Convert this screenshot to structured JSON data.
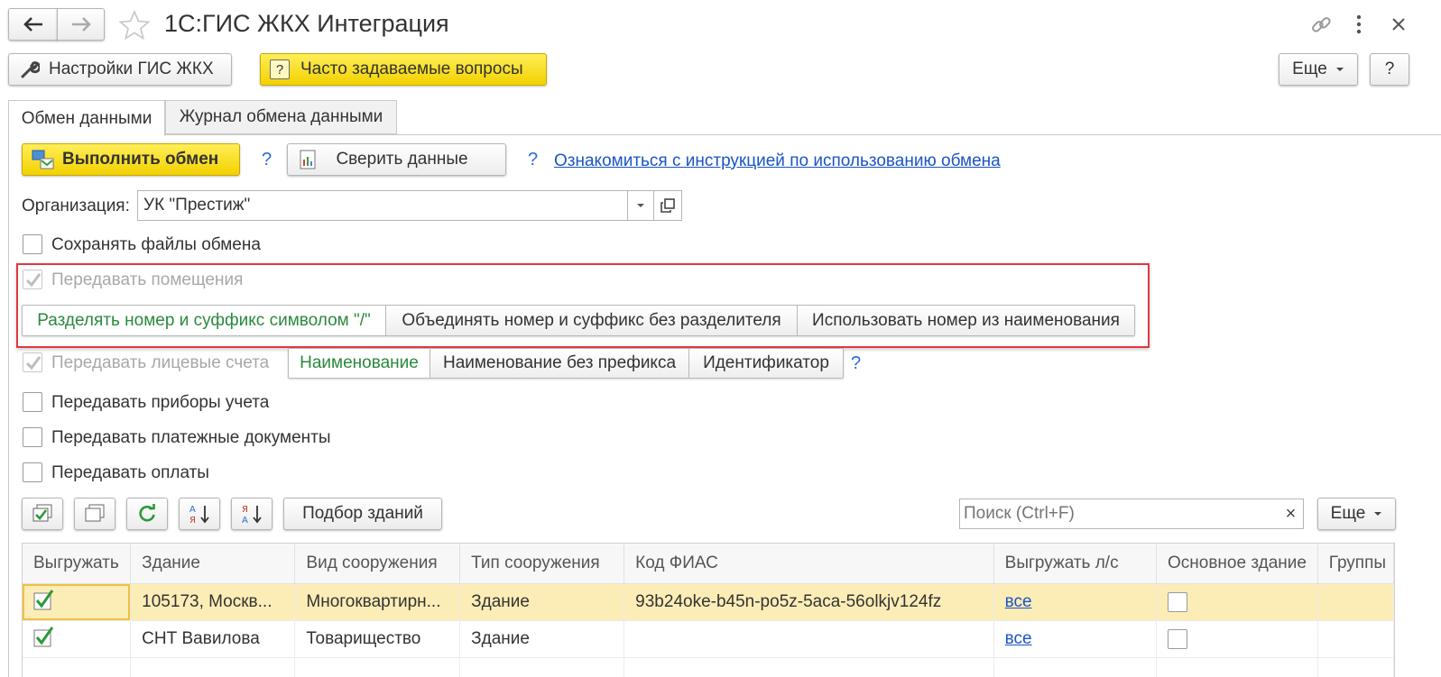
{
  "window": {
    "title": "1С:ГИС ЖКХ Интеграция",
    "back_icon": "arrow-left-icon",
    "forward_icon": "arrow-right-icon"
  },
  "toolbar": {
    "settings_label": "Настройки ГИС ЖКХ",
    "faq_label": "Часто задаваемые вопросы",
    "more_label": "Еще",
    "help_label": "?"
  },
  "tabs": [
    {
      "label": "Обмен данными",
      "active": true
    },
    {
      "label": "Журнал обмена данными",
      "active": false
    }
  ],
  "exchange": {
    "run_label": "Выполнить обмен",
    "q1": "?",
    "reconcile_label": "Сверить данные",
    "q2": "?",
    "instruction_link": "Ознакомиться с инструкцией по использованию обмена"
  },
  "org": {
    "label": "Организация:",
    "value": "УК \"Престиж\""
  },
  "options": {
    "save_files": {
      "label": "Сохранять файлы обмена",
      "checked": false
    },
    "premises": {
      "label": "Передавать помещения",
      "checked": true,
      "disabled": true
    },
    "premises_modes": [
      "Разделять номер и суффикс символом \"/\"",
      "Объединять номер и суффикс без разделителя",
      "Использовать номер из наименования"
    ],
    "accounts": {
      "label": "Передавать лицевые счета",
      "checked": true,
      "disabled": true
    },
    "account_modes": [
      "Наименование",
      "Наименование без префикса",
      "Идентификатор"
    ],
    "accounts_q": "?",
    "meters": {
      "label": "Передавать приборы учета",
      "checked": false
    },
    "payment_docs": {
      "label": "Передавать платежные документы",
      "checked": false
    },
    "payments": {
      "label": "Передавать оплаты",
      "checked": false
    }
  },
  "list_toolbar": {
    "pick_buildings_label": "Подбор зданий",
    "search_placeholder": "Поиск (Ctrl+F)",
    "clear_label": "×",
    "more_label": "Еще"
  },
  "table": {
    "columns": [
      "Выгружать",
      "Здание",
      "Вид сооружения",
      "Тип сооружения",
      "Код ФИАС",
      "Выгружать л/с",
      "Основное здание",
      "Группы"
    ],
    "rows": [
      {
        "export": true,
        "building": "105173, Москв...",
        "kind": "Многоквартирн...",
        "type": "Здание",
        "fias": "93b24oke-b45n-po5z-5aca-56olkjv124fz",
        "accounts": "все",
        "main": false
      },
      {
        "export": true,
        "building": "СНТ Вавилова",
        "kind": "Товарищество",
        "type": "Здание",
        "fias": "",
        "accounts": "все",
        "main": false
      }
    ]
  },
  "colors": {
    "accent_yellow": "#f2d100",
    "active_green": "#2a8a3c",
    "link_blue": "#1a55c5",
    "highlight_red": "#e0383e",
    "selected_row": "#fcedb6"
  }
}
